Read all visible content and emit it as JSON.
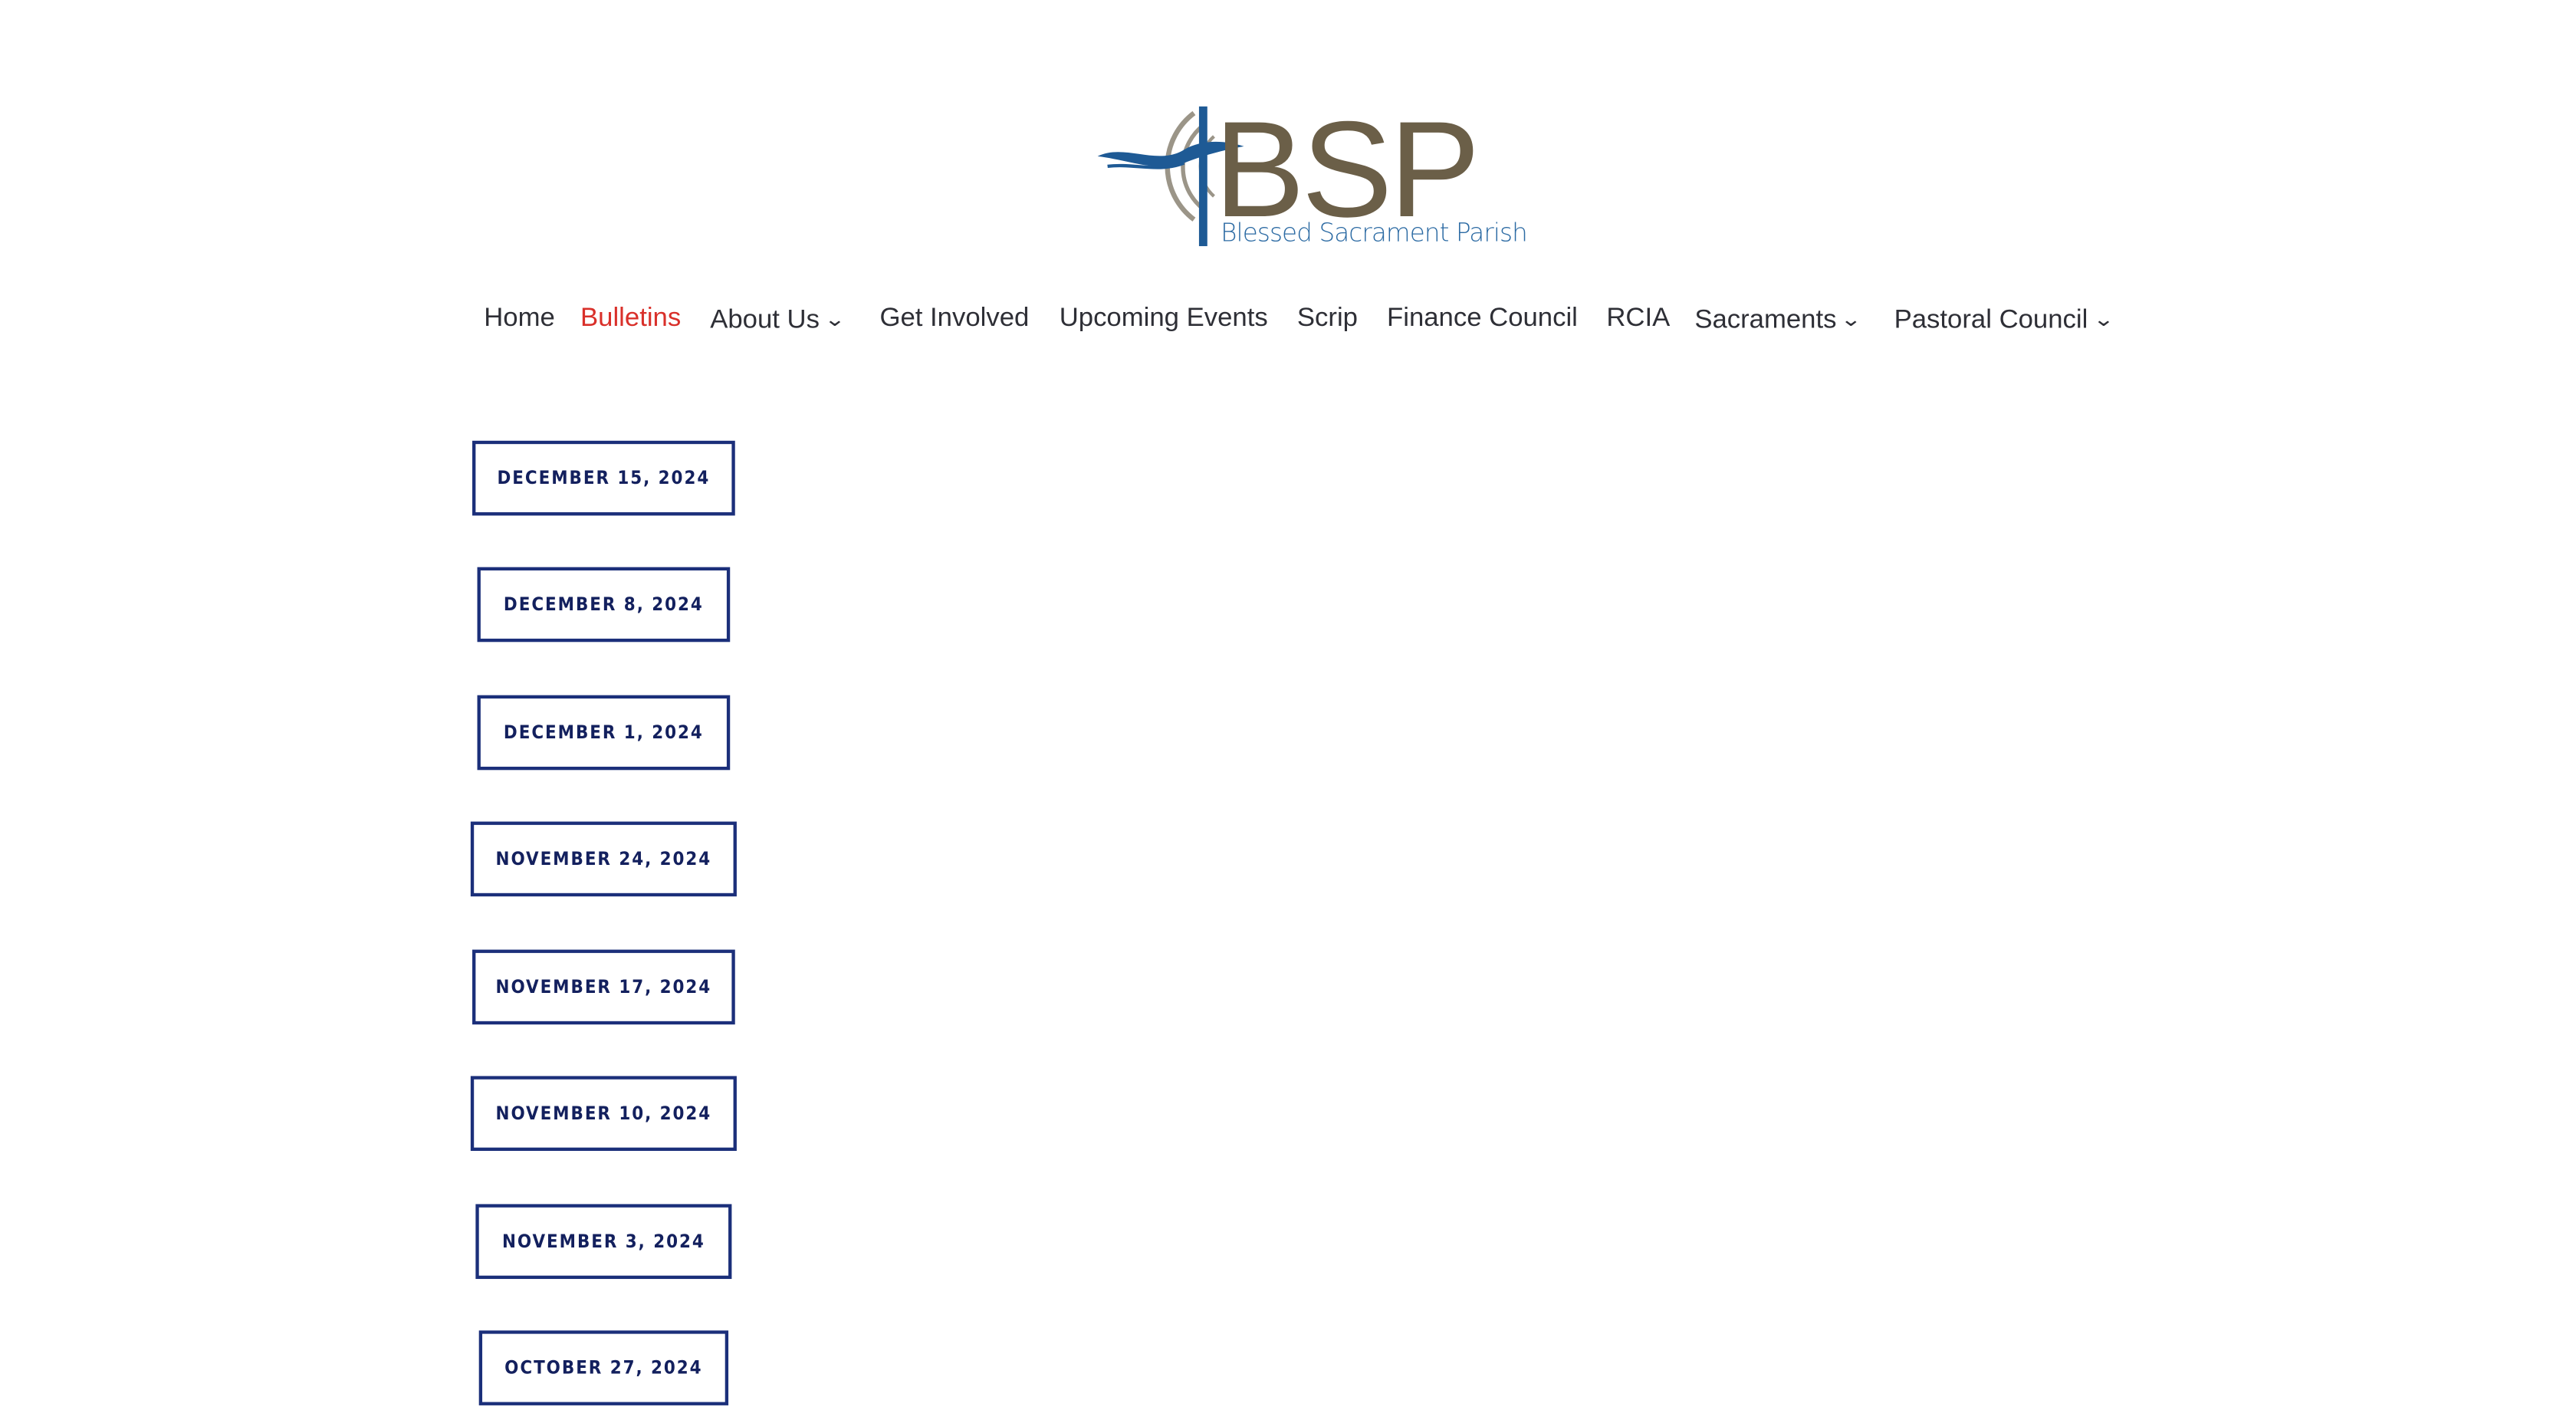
{
  "site": {
    "logo_text": "BSP",
    "logo_subtitle": "Blessed Sacrament Parish",
    "colors": {
      "logo_brown": "#6b5f48",
      "logo_blue": "#1e5a95",
      "nav_text": "#2e2f36",
      "nav_active": "#d9302a",
      "button_border": "#1b2f7a",
      "button_text": "#13205e"
    }
  },
  "nav": {
    "items": [
      {
        "label": "Home",
        "active": false,
        "has_dropdown": false
      },
      {
        "label": "Bulletins",
        "active": true,
        "has_dropdown": false
      },
      {
        "label": "About Us",
        "active": false,
        "has_dropdown": true
      },
      {
        "label": "Get Involved",
        "active": false,
        "has_dropdown": false
      },
      {
        "label": "Upcoming Events",
        "active": false,
        "has_dropdown": false
      },
      {
        "label": "Scrip",
        "active": false,
        "has_dropdown": false
      },
      {
        "label": "Finance Council",
        "active": false,
        "has_dropdown": false
      },
      {
        "label": "RCIA",
        "active": false,
        "has_dropdown": false
      },
      {
        "label": "Sacraments",
        "active": false,
        "has_dropdown": true
      },
      {
        "label": "Pastoral Council",
        "active": false,
        "has_dropdown": true
      }
    ],
    "dropdown_icon": "chevron-down-icon"
  },
  "bulletins": [
    {
      "label": "December 15, 2024"
    },
    {
      "label": "December 8, 2024"
    },
    {
      "label": "December 1, 2024"
    },
    {
      "label": "November 24, 2024"
    },
    {
      "label": "November 17, 2024"
    },
    {
      "label": "November 10, 2024"
    },
    {
      "label": "November 3, 2024"
    },
    {
      "label": "October 27, 2024"
    }
  ]
}
